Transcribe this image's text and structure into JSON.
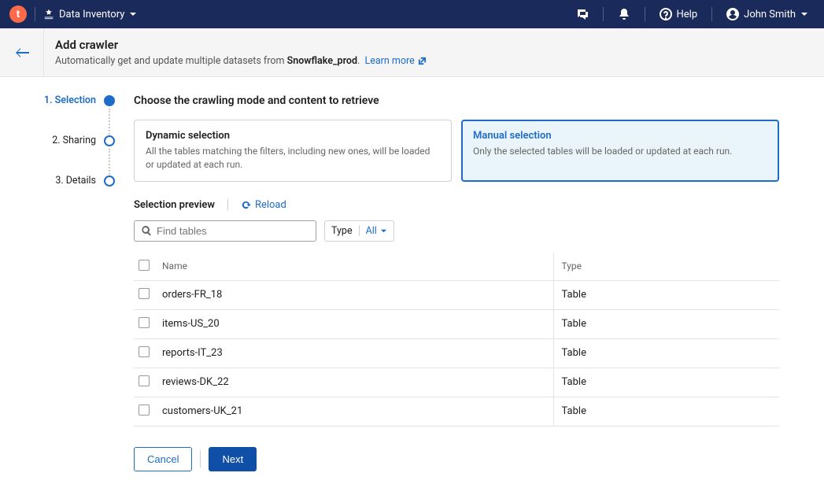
{
  "nav": {
    "app_dropdown": "Data Inventory",
    "help_label": "Help",
    "user_name": "John Smith"
  },
  "header": {
    "title": "Add crawler",
    "subtitle_prefix": "Automatically get and update multiple datasets from ",
    "connection_name": "Snowflake_prod",
    "subtitle_suffix": ".",
    "learn_more": "Learn more"
  },
  "steps": [
    {
      "label": "1. Selection",
      "active": true
    },
    {
      "label": "2. Sharing",
      "active": false
    },
    {
      "label": "3. Details",
      "active": false
    }
  ],
  "section_title": "Choose the crawling mode and content to retrieve",
  "modes": {
    "dynamic": {
      "title": "Dynamic selection",
      "desc": "All the tables matching the filters, including new ones, will be loaded or updated at each run."
    },
    "manual": {
      "title": "Manual selection",
      "desc": "Only the selected tables will be loaded or updated at each run."
    },
    "selected": "manual"
  },
  "preview": {
    "label": "Selection preview",
    "reload": "Reload"
  },
  "search": {
    "placeholder": "Find tables"
  },
  "type_filter": {
    "label": "Type",
    "value": "All"
  },
  "table": {
    "col_name": "Name",
    "col_type": "Type",
    "rows": [
      {
        "name": "orders-FR_18",
        "type": "Table"
      },
      {
        "name": "items-US_20",
        "type": "Table"
      },
      {
        "name": "reports-IT_23",
        "type": "Table"
      },
      {
        "name": "reviews-DK_22",
        "type": "Table"
      },
      {
        "name": "customers-UK_21",
        "type": "Table"
      }
    ]
  },
  "footer": {
    "cancel": "Cancel",
    "next": "Next"
  }
}
